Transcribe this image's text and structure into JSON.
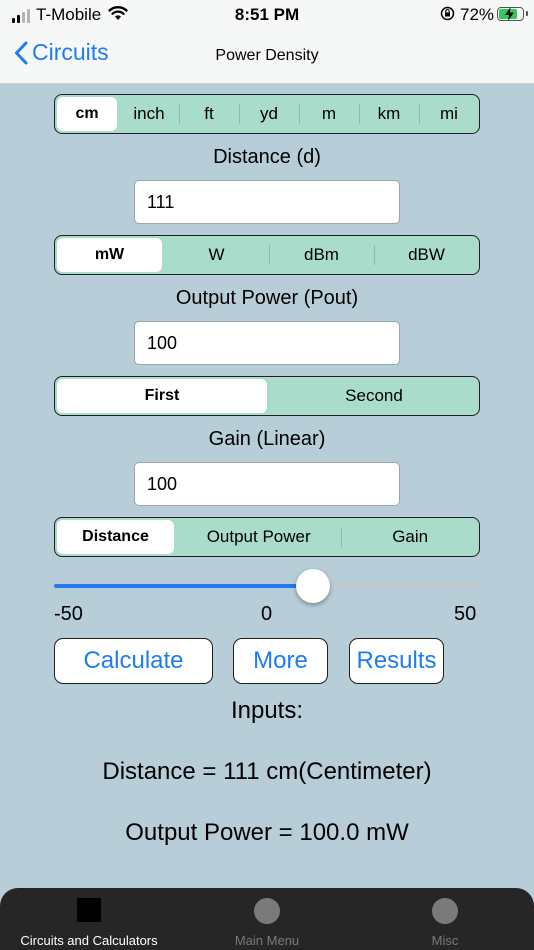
{
  "status_bar": {
    "carrier": "T-Mobile",
    "time": "8:51 PM",
    "battery": "72%"
  },
  "nav": {
    "back_label": "Circuits",
    "title": "Power Density"
  },
  "distance_units": {
    "options": [
      "cm",
      "inch",
      "ft",
      "yd",
      "m",
      "km",
      "mi"
    ],
    "selected": "cm"
  },
  "distance": {
    "label": "Distance (d)",
    "value": "111"
  },
  "power_units": {
    "options": [
      "mW",
      "W",
      "dBm",
      "dBW"
    ],
    "selected": "mW"
  },
  "output_power": {
    "label": "Output Power (Pout)",
    "value": "100"
  },
  "gain_mode": {
    "options": [
      "First",
      "Second"
    ],
    "selected": "First"
  },
  "gain": {
    "label": "Gain (Linear)",
    "value": "100"
  },
  "solve_for": {
    "options": [
      "Distance",
      "Output Power",
      "Gain"
    ],
    "selected": "Distance"
  },
  "slider": {
    "min_label": "-50",
    "mid_label": "0",
    "max_label": "50",
    "value": 11
  },
  "buttons": {
    "calculate": "Calculate",
    "more": "More",
    "results": "Results"
  },
  "results": {
    "heading": "Inputs:",
    "line1": "Distance = 111 cm(Centimeter)",
    "line2": "Output Power = 100.0 mW"
  },
  "tabs": [
    {
      "label": "Circuits and Calculators",
      "icon": "square-icon",
      "active": true
    },
    {
      "label": "Main Menu",
      "icon": "circle-icon",
      "active": false
    },
    {
      "label": "Misc",
      "icon": "circle-icon",
      "active": false
    }
  ],
  "colors": {
    "accent": "#1e7cf2",
    "segment_bg": "#aadccb",
    "page_bg": "#b7cdd8",
    "tabbar_bg": "#262626"
  }
}
